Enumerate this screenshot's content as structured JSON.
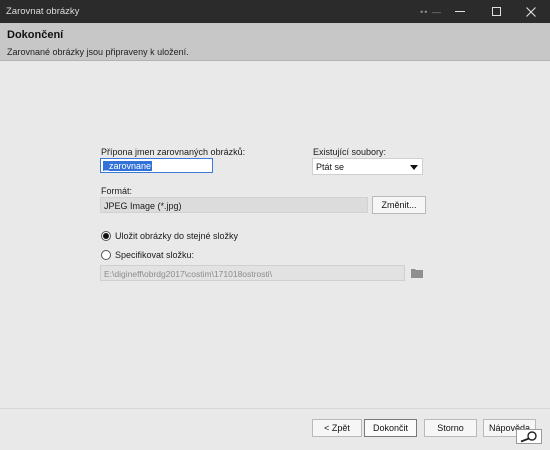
{
  "window": {
    "title": "Zarovnat obrázky",
    "dots": "•• —"
  },
  "header": {
    "title": "Dokončení",
    "subtitle": "Zarovnané obrázky jsou připraveny k uložení."
  },
  "form": {
    "suffix_label": "Přípona jmen zarovnaných obrázků:",
    "suffix_value": "_zarovnane",
    "existing_label": "Existující soubory:",
    "existing_value": "Ptát se",
    "format_label": "Formát:",
    "format_value": "JPEG Image (*.jpg)",
    "change_button": "Změnit...",
    "radio_same_folder": "Uložit obrázky do stejné složky",
    "radio_specify_folder": "Specifikovat složku:",
    "folder_path": "E:\\digineff\\obrdg2017\\costim\\171018ostrosti\\",
    "selected_option": "same-folder"
  },
  "footer": {
    "back": "< Zpět",
    "finish": "Dokončit",
    "cancel": "Storno",
    "help": "Nápověda"
  }
}
